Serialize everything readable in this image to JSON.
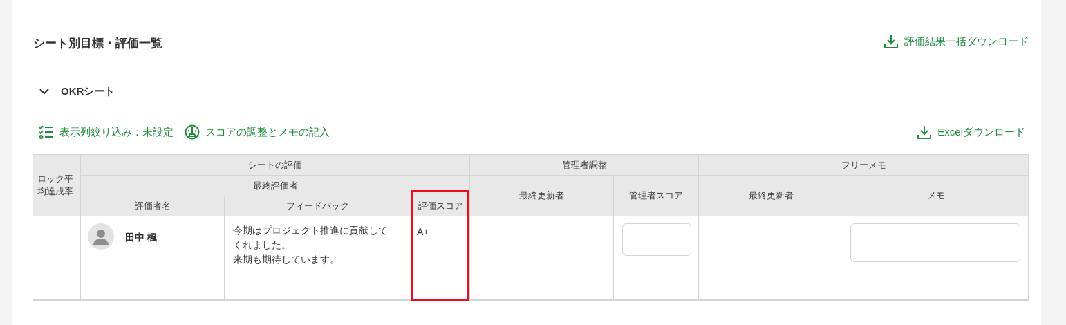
{
  "title": "シート別目標・評価一覧",
  "bulk_download": "評価結果一括ダウンロード",
  "sheet": {
    "name": "OKRシート",
    "expanded": true,
    "toolbar": {
      "column_filter": "表示列絞り込み：未設定",
      "adjust": "スコアの調整とメモの記入",
      "excel": "Excelダウンロード"
    },
    "table": {
      "column_1": "ロック平均達成率",
      "sheet_eval": {
        "label": "シートの評価",
        "final": "最終評価者",
        "columns": [
          {
            "label": "評価者名",
            "highlighted": false
          },
          {
            "label": "フィードバック",
            "highlighted": false
          },
          {
            "label": "評価スコア",
            "highlighted": true
          }
        ]
      },
      "admin": {
        "label": "管理者調整",
        "columns": [
          "最終更新者",
          "管理者スコア"
        ]
      },
      "memo": {
        "label": "フリーメモ",
        "columns": [
          "最終更新者",
          "メモ"
        ]
      },
      "rows": [
        {
          "evaluator": "田中 楓",
          "feedback": [
            "今期はプロジェクト推進に貢献して",
            "くれました。",
            "来期も期待しています。"
          ],
          "score": "A+"
        }
      ]
    }
  }
}
